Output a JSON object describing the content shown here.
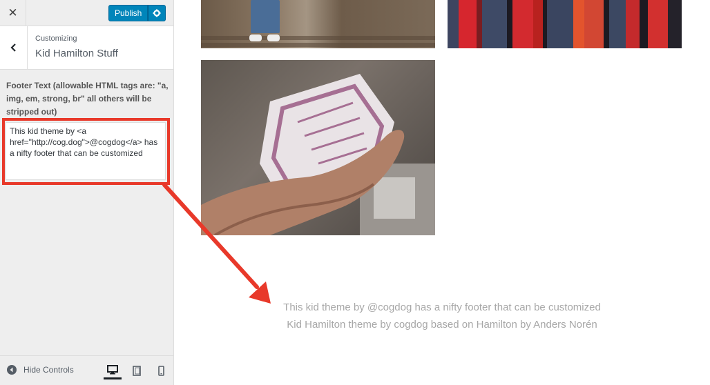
{
  "header": {
    "close_icon": "close-icon",
    "publish_label": "Publish",
    "settings_icon": "gear-icon"
  },
  "section": {
    "back_icon": "chevron-left-icon",
    "customizing_label": "Customizing",
    "panel_title": "Kid Hamilton Stuff"
  },
  "control": {
    "label": "Footer Text (allowable HTML tags are: \"a, img, em, strong, br\" all others will be stripped out)",
    "value": "This kid theme by <a href=\"http://cog.dog\">@cogdog</a> has a nifty footer that can be customized"
  },
  "footer_bar": {
    "hide_controls_label": "Hide Controls",
    "devices": [
      "desktop-icon",
      "tablet-icon",
      "mobile-icon"
    ],
    "active_device": "desktop-icon"
  },
  "preview": {
    "footer_line1": "This kid theme by @cogdog has a nifty footer that can be customized",
    "footer_line2": "Kid Hamilton theme by cogdog based on Hamilton by Anders Norén"
  },
  "colors": {
    "accent": "#0085ba",
    "annotation": "#e8392a",
    "footer_text": "#a7a7a7"
  }
}
